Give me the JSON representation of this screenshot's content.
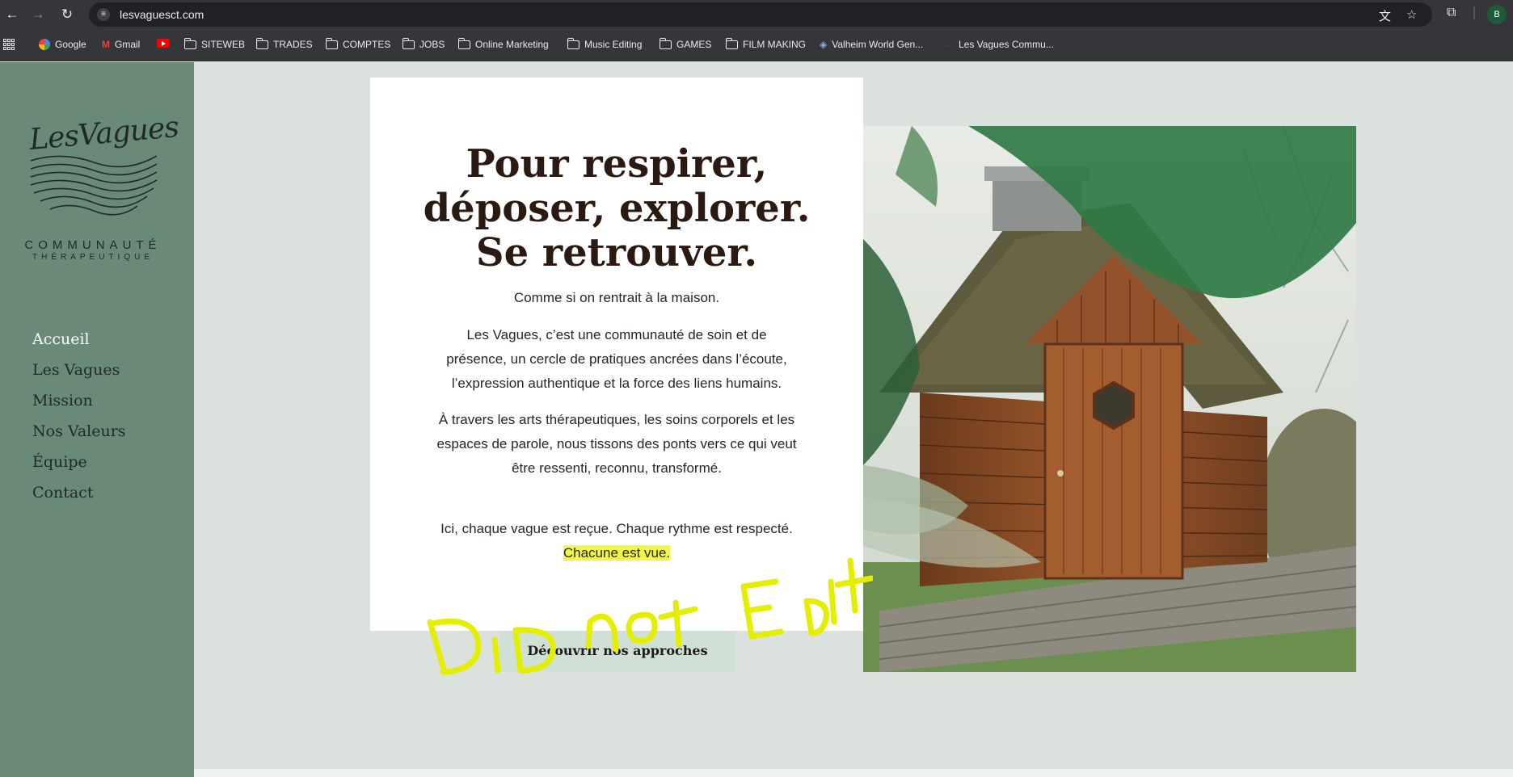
{
  "browser": {
    "url": "lesvaguesct.com",
    "profile_initial": "B",
    "bookmarks": [
      "Google",
      "Gmail",
      "SITEWEB",
      "TRADES",
      "COMPTES",
      "JOBS",
      "Online Marketing",
      "Music Editing",
      "GAMES",
      "FILM MAKING",
      "Valheim World Gen...",
      "Les Vagues Commu..."
    ]
  },
  "logo": {
    "script": "LesVagues",
    "line1": "COMMUNAUTÉ",
    "line2": "THÉRAPEUTIQUE"
  },
  "nav": {
    "items": [
      "Accueil",
      "Les Vagues",
      "Mission",
      "Nos Valeurs",
      "Équipe",
      "Contact"
    ],
    "active": "Accueil"
  },
  "hero": {
    "headline": [
      "Pour respirer,",
      "déposer, explorer.",
      "Se retrouver."
    ],
    "tagline": "Comme si on rentrait à la maison.",
    "para1": "Les Vagues, c’est une communauté de soin et de présence, un cercle de pratiques ancrées dans l’écoute, l’expression authentique et la force des liens humains.",
    "para2": "À travers les arts thérapeutiques, les soins corporels et les espaces de parole, nous tissons des ponts vers ce qui veut être ressenti, reconnu, transformé.",
    "para3_start": "Ici, chaque vague est reçue. Chaque rythme est respecté.",
    "para3_highlight": "Chacune est vue.",
    "cta": "Découvrir nos approches"
  },
  "annotation": {
    "text": "Did not Edit",
    "color": "#e6f000"
  },
  "colors": {
    "sidebar": "#6a8a78",
    "page_bg": "#dbe2dd",
    "cta_bg": "#cfe1d6"
  }
}
